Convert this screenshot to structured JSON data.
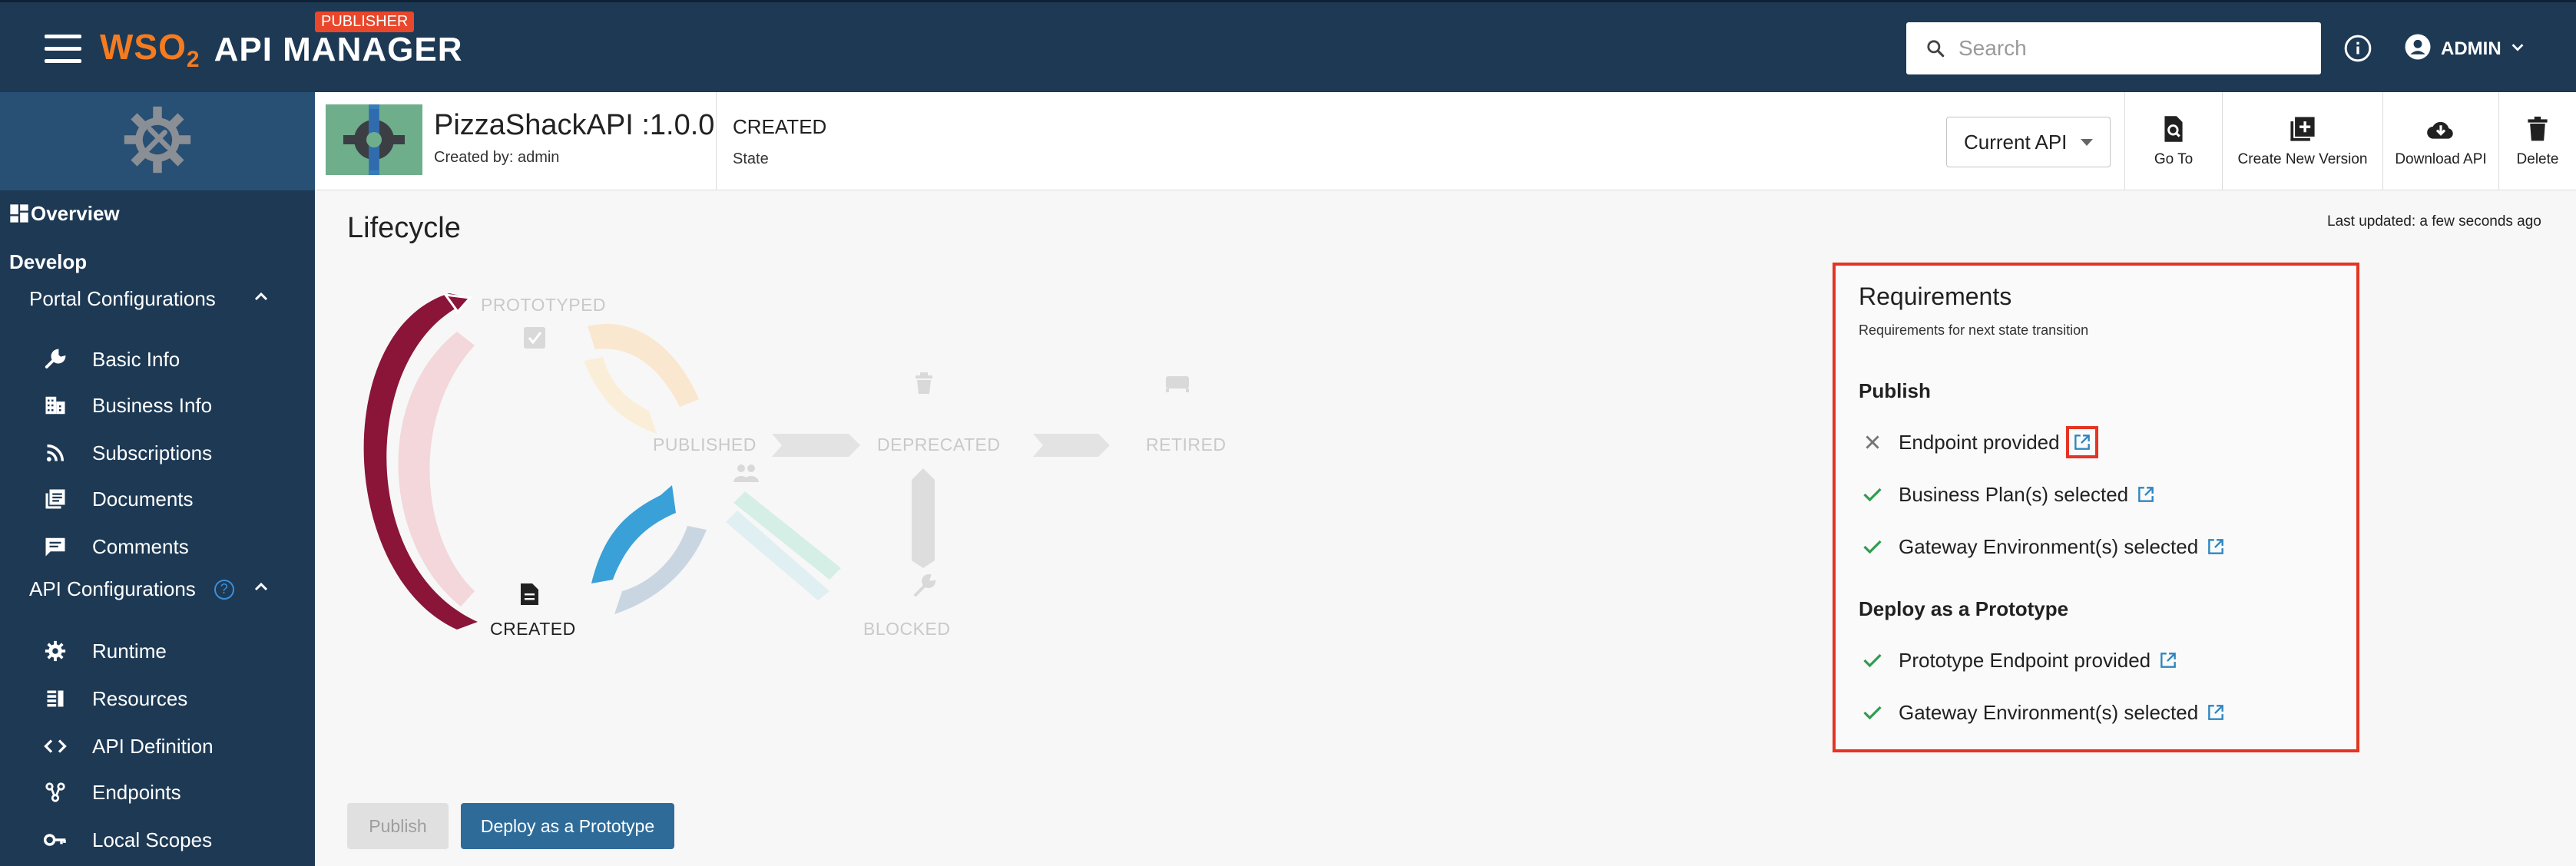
{
  "app": {
    "brand": "WSO",
    "brand_sub": "2",
    "title": "API MANAGER",
    "badge": "PUBLISHER"
  },
  "search": {
    "placeholder": "Search"
  },
  "user": {
    "name": "ADMIN"
  },
  "sidebar": {
    "overview": "Overview",
    "develop": "Develop",
    "portal_configurations": "Portal Configurations",
    "portal_items": [
      {
        "label": "Basic Info",
        "icon": "wrench-icon"
      },
      {
        "label": "Business Info",
        "icon": "business-icon"
      },
      {
        "label": "Subscriptions",
        "icon": "rss-icon"
      },
      {
        "label": "Documents",
        "icon": "documents-icon"
      },
      {
        "label": "Comments",
        "icon": "comment-icon"
      }
    ],
    "api_configurations": "API Configurations",
    "api_config_help": "?",
    "api_items": [
      {
        "label": "Runtime",
        "icon": "gear-icon"
      },
      {
        "label": "Resources",
        "icon": "resources-icon"
      },
      {
        "label": "API Definition",
        "icon": "code-icon"
      },
      {
        "label": "Endpoints",
        "icon": "endpoints-icon"
      },
      {
        "label": "Local Scopes",
        "icon": "key-icon"
      }
    ]
  },
  "api": {
    "name": "PizzaShackAPI :1.0.0",
    "created_by": "Created by: admin",
    "state": "CREATED",
    "state_label": "State",
    "version_select": "Current API"
  },
  "toolbar": {
    "goto": "Go To",
    "create_version": "Create New Version",
    "download": "Download API",
    "delete": "Delete"
  },
  "page": {
    "title": "Lifecycle",
    "last_updated": "Last updated: a few seconds ago"
  },
  "lifecycle": {
    "states": {
      "prototyped": "PROTOTYPED",
      "published": "PUBLISHED",
      "deprecated": "DEPRECATED",
      "retired": "RETIRED",
      "created": "CREATED",
      "blocked": "BLOCKED"
    },
    "current": "CREATED"
  },
  "requirements": {
    "title": "Requirements",
    "subtitle": "Requirements for next state transition",
    "publish_heading": "Publish",
    "publish_items": [
      {
        "label": "Endpoint provided",
        "status": "missing"
      },
      {
        "label": "Business Plan(s) selected",
        "status": "ok"
      },
      {
        "label": "Gateway Environment(s) selected",
        "status": "ok"
      }
    ],
    "prototype_heading": "Deploy as a Prototype",
    "prototype_items": [
      {
        "label": "Prototype Endpoint provided",
        "status": "ok"
      },
      {
        "label": "Gateway Environment(s) selected",
        "status": "ok"
      }
    ]
  },
  "actions": {
    "publish": "Publish",
    "deploy_prototype": "Deploy as a Prototype"
  },
  "colors": {
    "nav_bg": "#1d3954",
    "accent_orange": "#f47b20",
    "highlight_red": "#e53423",
    "primary_blue": "#2e6b99",
    "check_green": "#2e9e4e",
    "created_arc": "#8a1538"
  }
}
